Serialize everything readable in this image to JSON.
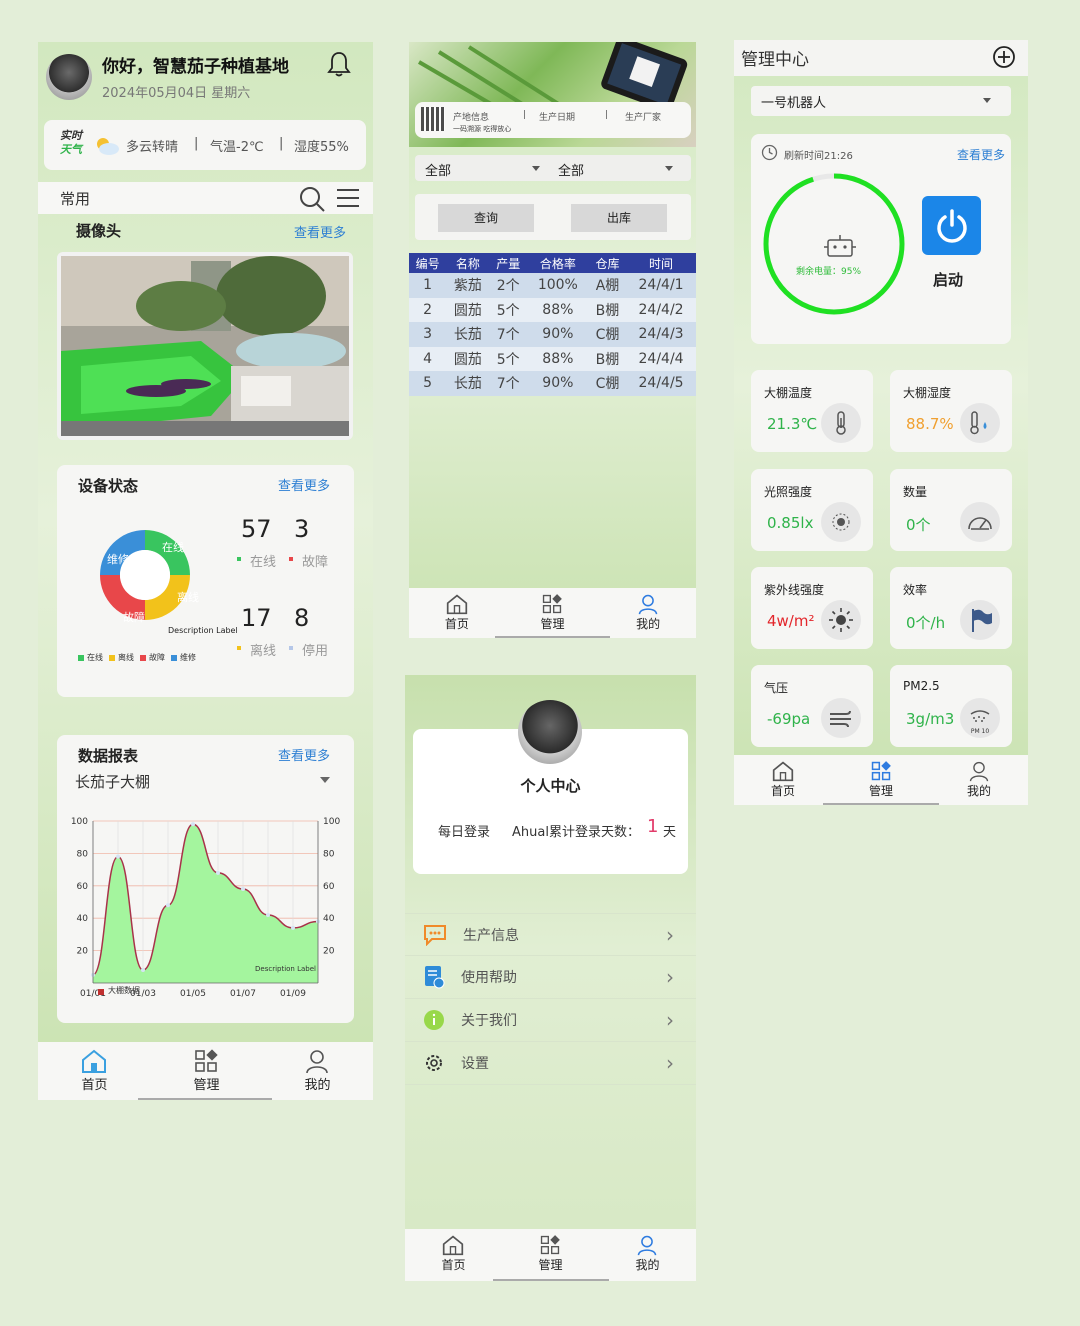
{
  "home": {
    "greeting": "你好，智慧茄子种植基地",
    "date": "2024年05月04日 星期六",
    "weather": {
      "logo_line1": "实时",
      "logo_line2": "天气",
      "condition": "多云转晴",
      "temp": "气温-2℃",
      "humidity": "湿度55%",
      "sep": "|"
    },
    "common_label": "常用",
    "camera_title": "摄像头",
    "see_more": "查看更多",
    "device_status": {
      "title": "设备状态",
      "online_count": "57",
      "fault_count": "3",
      "offline_count": "17",
      "stopped_count": "8",
      "online": "在线",
      "fault": "故障",
      "offline": "离线",
      "stopped": "停用",
      "repair": "维修",
      "desc_label": "Description Label",
      "legend": [
        "在线",
        "离线",
        "故障",
        "维修"
      ],
      "colors": {
        "online": "#39c55f",
        "offline": "#f2c21b",
        "fault": "#e8474a",
        "repair": "#3a8fd8"
      }
    },
    "report": {
      "title": "数据报表",
      "dropdown": "长茄子大棚",
      "legend": "大棚数据",
      "desc_label": "Description Label"
    }
  },
  "chart_data": {
    "type": "area",
    "x": [
      "01/01",
      "01/02",
      "01/03",
      "01/04",
      "01/05",
      "01/06",
      "01/07",
      "01/08",
      "01/09",
      "01/10"
    ],
    "x_tick_labels": [
      "01/01",
      "01/03",
      "01/05",
      "01/07",
      "01/09"
    ],
    "series": [
      {
        "name": "大棚数据",
        "values": [
          5,
          78,
          8,
          48,
          98,
          68,
          58,
          42,
          34,
          38
        ]
      }
    ],
    "ylim": [
      0,
      100
    ],
    "yticks": [
      20,
      40,
      60,
      80,
      100
    ],
    "grid": true,
    "legend": "bottom-left"
  },
  "tabs": {
    "home": "首页",
    "manage": "管理",
    "mine": "我的"
  },
  "production": {
    "trace_labels": [
      "产地信息",
      "生产日期",
      "生产厂家"
    ],
    "trace_sub": "一码溯源 吃得放心",
    "filter1": "全部",
    "filter2": "全部",
    "query_button": "查询",
    "out_button": "出库",
    "headers": [
      "编号",
      "名称",
      "产量",
      "合格率",
      "仓库",
      "时间"
    ],
    "rows": [
      [
        "1",
        "紫茄",
        "2个",
        "100%",
        "A棚",
        "24/4/1"
      ],
      [
        "2",
        "圆茄",
        "5个",
        "88%",
        "B棚",
        "24/4/2"
      ],
      [
        "3",
        "长茄",
        "7个",
        "90%",
        "C棚",
        "24/4/3"
      ],
      [
        "4",
        "圆茄",
        "5个",
        "88%",
        "B棚",
        "24/4/4"
      ],
      [
        "5",
        "长茄",
        "7个",
        "90%",
        "C棚",
        "24/4/5"
      ]
    ]
  },
  "profile": {
    "title": "个人中心",
    "daily_login": "每日登录",
    "login_days_label": "Ahual累计登录天数：",
    "login_days": "1",
    "days_unit": "天",
    "menu": [
      "生产信息",
      "使用帮助",
      "关于我们",
      "设置"
    ]
  },
  "manage": {
    "title": "管理中心",
    "robot": "一号机器人",
    "refresh": "刷新时间21:26",
    "see_more": "查看更多",
    "battery_label": "剩余电量：",
    "battery": "95%",
    "battery_fraction": 0.95,
    "start": "启动",
    "sensors": [
      {
        "label": "大棚温度",
        "value": "21.3℃",
        "color": "#2fb34a",
        "icon": "thermometer-icon"
      },
      {
        "label": "大棚湿度",
        "value": "88.7%",
        "color": "#f0a030",
        "icon": "humidity-icon"
      },
      {
        "label": "光照强度",
        "value": "0.85lx",
        "color": "#2fb34a",
        "icon": "light-sensor-icon"
      },
      {
        "label": "数量",
        "value": "0个",
        "color": "#2fb34a",
        "icon": "gauge-icon"
      },
      {
        "label": "紫外线强度",
        "value": "4w/m²",
        "color": "#e3262b",
        "icon": "sun-icon"
      },
      {
        "label": "效率",
        "value": "0个/h",
        "color": "#2fb34a",
        "icon": "flag-icon"
      },
      {
        "label": "气压",
        "value": "-69pa",
        "color": "#2fb34a",
        "icon": "wind-icon"
      },
      {
        "label": "PM2.5",
        "value": "3g/m3",
        "color": "#2fb34a",
        "icon": "pm10-icon"
      }
    ],
    "pm_badge": "PM 10"
  }
}
